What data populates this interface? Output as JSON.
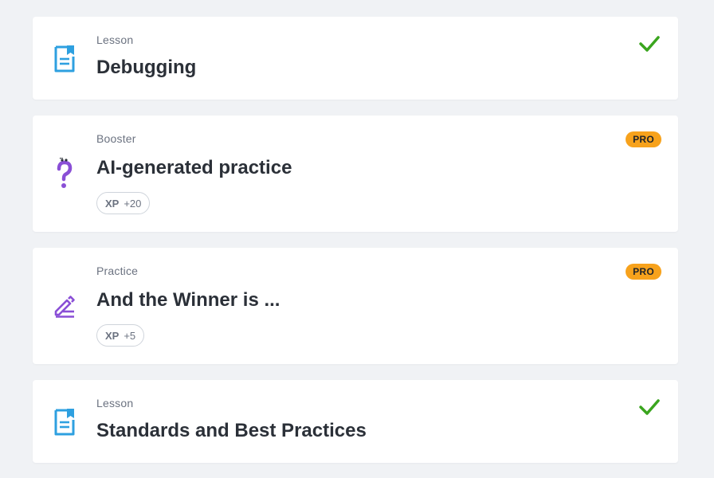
{
  "colors": {
    "lesson_icon": "#2ea0e0",
    "booster_icon": "#8a4fd6",
    "practice_icon": "#8a4fd6",
    "check": "#3aa51e",
    "pro_badge": "#f7a21c"
  },
  "cards": [
    {
      "type": "Lesson",
      "title": "Debugging",
      "icon": "lesson-document-icon",
      "status": "completed"
    },
    {
      "type": "Booster",
      "title": "AI-generated practice",
      "icon": "question-mark-icon",
      "badge": "PRO",
      "xp_label": "XP",
      "xp_value": "+20"
    },
    {
      "type": "Practice",
      "title": "And the Winner is ...",
      "icon": "pencil-edit-icon",
      "badge": "PRO",
      "xp_label": "XP",
      "xp_value": "+5"
    },
    {
      "type": "Lesson",
      "title": "Standards and Best Practices",
      "icon": "lesson-document-icon",
      "status": "completed"
    }
  ]
}
